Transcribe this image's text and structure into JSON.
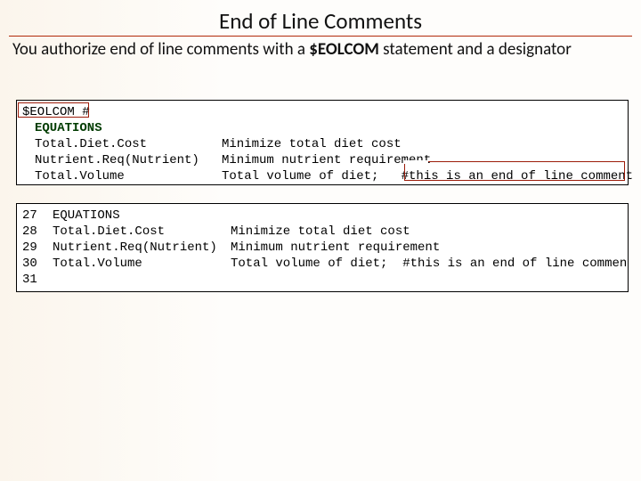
{
  "title": "End of Line Comments",
  "subtitle_pre": "You authorize  end of line comments with a ",
  "subtitle_kw": "$EOLCOM",
  "subtitle_post": " statement and a designator",
  "code1": {
    "line1": "$EOLCOM #",
    "line2": "EQUATIONS",
    "r1c1": "Total.Diet.Cost",
    "r1c2": "Minimize total diet cost",
    "r2c1": "Nutrient.Req(Nutrient)",
    "r2c2": "Minimum nutrient requirement",
    "r3c1": "Total.Volume",
    "r3c2": "Total volume of diet;   #this is an end of line comment"
  },
  "code2": {
    "rows": [
      {
        "ln": "27",
        "c1": "EQUATIONS",
        "c2": ""
      },
      {
        "ln": "28",
        "c1": "Total.Diet.Cost",
        "c2": "Minimize total diet cost"
      },
      {
        "ln": "29",
        "c1": "Nutrient.Req(Nutrient)",
        "c2": "Minimum nutrient requirement"
      },
      {
        "ln": "30",
        "c1": "Total.Volume",
        "c2": "Total volume of diet;  #this is an end of line comment"
      },
      {
        "ln": "31",
        "c1": "",
        "c2": ""
      }
    ]
  }
}
